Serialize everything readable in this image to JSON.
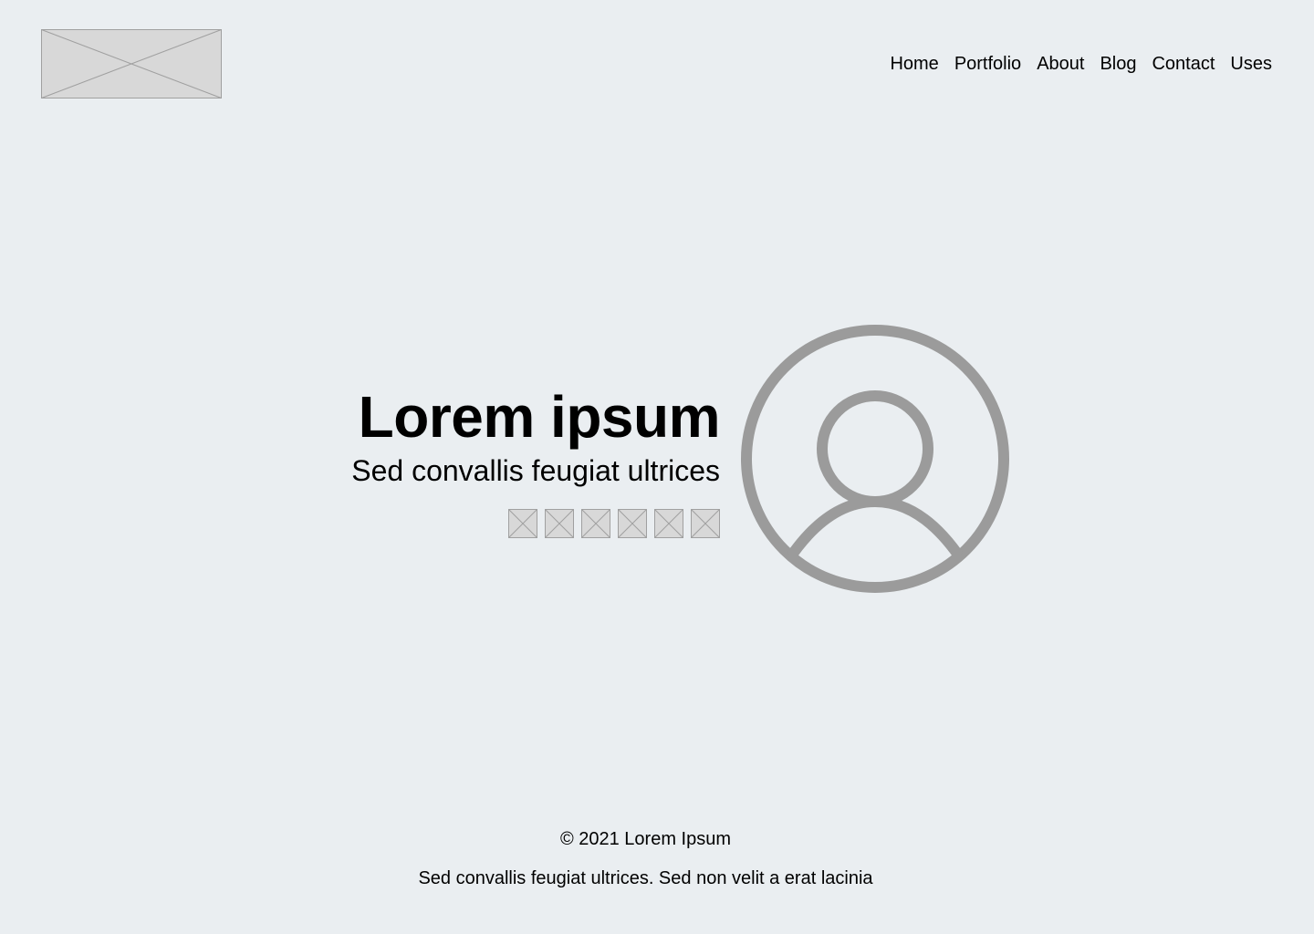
{
  "header": {
    "logo_icon": "image-placeholder-icon",
    "nav": [
      {
        "label": "Home"
      },
      {
        "label": "Portfolio"
      },
      {
        "label": "About"
      },
      {
        "label": "Blog"
      },
      {
        "label": "Contact"
      },
      {
        "label": "Uses"
      }
    ]
  },
  "hero": {
    "title": "Lorem ipsum",
    "subtitle": "Sed convallis feugiat ultrices",
    "social_icons": [
      "image-placeholder-icon",
      "image-placeholder-icon",
      "image-placeholder-icon",
      "image-placeholder-icon",
      "image-placeholder-icon",
      "image-placeholder-icon"
    ],
    "avatar_icon": "user-avatar-icon"
  },
  "footer": {
    "copyright": "© 2021 Lorem Ipsum",
    "tagline": "Sed convallis feugiat ultrices. Sed non velit a erat lacinia"
  },
  "colors": {
    "background": "#eaeef1",
    "placeholder_fill": "#d8d8d8",
    "placeholder_stroke": "#a0a0a0",
    "avatar_stroke": "#9b9b9b",
    "text": "#000000"
  }
}
